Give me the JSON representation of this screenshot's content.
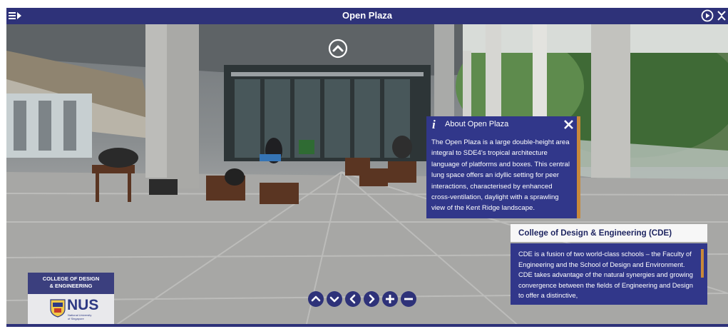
{
  "window": {
    "title": "Open Plaza"
  },
  "info_panel": {
    "title": "About Open Plaza",
    "body": "The Open Plaza is a large double-height area integral to SDE4's tropical architecture language of platforms and boxes. This central lung space offers an idyllic setting for peer interactions, characterised by enhanced cross-ventilation, daylight with a sprawling view of the Kent Ridge landscape."
  },
  "cde_panel": {
    "title": "College of Design & Engineering (CDE)",
    "body": "CDE is a fusion of two world-class schools – the Faculty of Engineering and the School of Design and Environment. CDE takes advantage of the natural synergies and growing convergence between the fields of Engineering and Design to offer a distinctive,"
  },
  "logo": {
    "line1": "COLLEGE OF DESIGN",
    "line2": "& ENGINEERING",
    "brand": "NUS",
    "sub1": "National University",
    "sub2": "of Singapore"
  },
  "icons": {
    "menu": "menu-icon",
    "autoplay": "play-circle-icon",
    "fullscreen": "expand-icon",
    "hotspot": "chevron-up-circle-icon",
    "info": "info-icon",
    "close": "close-icon",
    "nav": [
      "chevron-up-icon",
      "chevron-down-icon",
      "chevron-left-icon",
      "chevron-right-icon",
      "zoom-in-icon",
      "zoom-out-icon"
    ]
  },
  "colors": {
    "bar": "#2e3279",
    "panel": "#31378a",
    "accent": "#c8893a"
  }
}
